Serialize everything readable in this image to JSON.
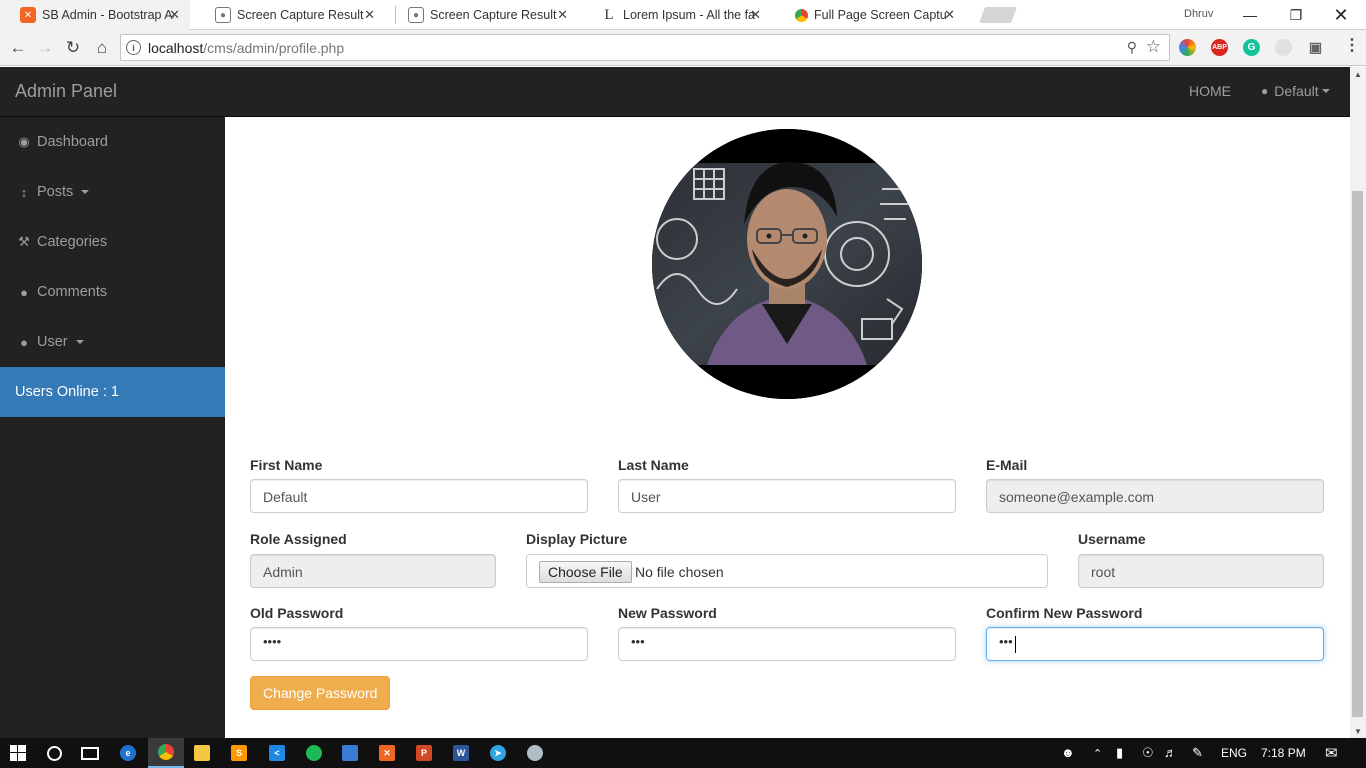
{
  "browser": {
    "tabs": [
      {
        "title": "SB Admin - Bootstrap Ad",
        "active": true,
        "favicon_color": "#f26522"
      },
      {
        "title": "Screen Capture Result",
        "active": false,
        "favicon_color": "#777777"
      },
      {
        "title": "Screen Capture Result",
        "active": false,
        "favicon_color": "#777777"
      },
      {
        "title": "Lorem Ipsum - All the fac",
        "active": false,
        "favicon_color": "#333333"
      },
      {
        "title": "Full Page Screen Capture",
        "active": false,
        "favicon_color": "#4285f4"
      }
    ],
    "profile_name": "Dhruv",
    "url_host": "localhost",
    "url_path": "/cms/admin/profile.php"
  },
  "app": {
    "brand": "Admin Panel",
    "nav_home": "HOME",
    "nav_user": "Default"
  },
  "sidebar": {
    "items": [
      {
        "label": "Dashboard",
        "icon": "dashboard-icon",
        "dropdown": false
      },
      {
        "label": "Posts",
        "icon": "arrows-v-icon",
        "dropdown": true
      },
      {
        "label": "Categories",
        "icon": "wrench-icon",
        "dropdown": false
      },
      {
        "label": "Comments",
        "icon": "comment-icon",
        "dropdown": false
      },
      {
        "label": "User",
        "icon": "user-icon",
        "dropdown": true
      }
    ],
    "online": "Users Online : 1"
  },
  "form": {
    "first_name": {
      "label": "First Name",
      "value": "Default"
    },
    "last_name": {
      "label": "Last Name",
      "value": "User"
    },
    "email": {
      "label": "E-Mail",
      "value": "someone@example.com"
    },
    "role": {
      "label": "Role Assigned",
      "value": "Admin"
    },
    "display_picture": {
      "label": "Display Picture",
      "button": "Choose File",
      "status": "No file chosen"
    },
    "username": {
      "label": "Username",
      "value": "root"
    },
    "old_password": {
      "label": "Old Password",
      "value": "••••"
    },
    "new_password": {
      "label": "New Password",
      "value": "•••"
    },
    "confirm_password": {
      "label": "Confirm New Password",
      "value": "•••"
    },
    "submit": "Change Password"
  },
  "taskbar": {
    "lang": "ENG",
    "time": "7:18 PM"
  },
  "colors": {
    "navbar_bg": "#222222",
    "online_bg": "#337ab7",
    "warning_btn": "#f0ad4e",
    "focus_border": "#66afe9"
  }
}
